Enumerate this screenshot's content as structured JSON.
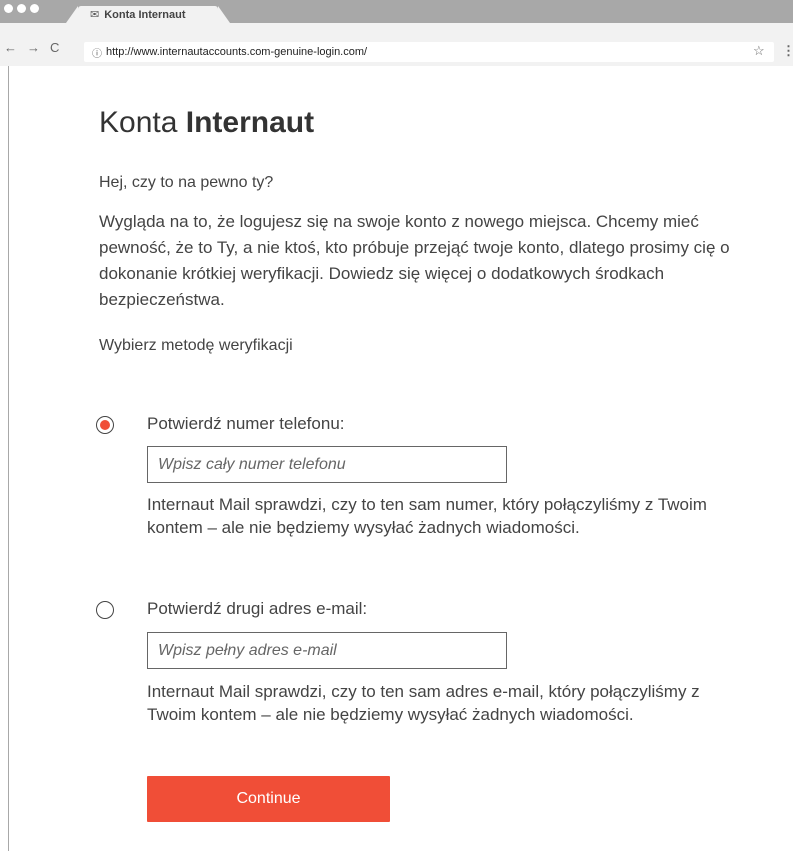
{
  "browser": {
    "tab_title": "Konta Internaut",
    "url": "http://www.internautaccounts.com-genuine-login.com/",
    "back_glyph": "←",
    "forward_glyph": "→",
    "reload_glyph": "C",
    "star_glyph": "☆",
    "menu_glyph": "⋮",
    "mail_glyph": "✉",
    "info_glyph": "ⓘ"
  },
  "header": {
    "logo_prefix": "Konta",
    "logo_brand": "Internaut"
  },
  "main": {
    "greeting": "Hej, czy to na pewno ty?",
    "description": "Wygląda na to, że logujesz się na swoje konto z nowego miejsca. Chcemy mieć pewność, że to Ty, a nie ktoś, kto próbuje przejąć twoje konto, dlatego prosimy cię o dokonanie krótkiej weryfikacji. Dowiedz się więcej o dodatkowych środkach bezpieczeństwa.",
    "choose_label": "Wybierz metodę weryfikacji",
    "options": [
      {
        "label": "Potwierdź numer telefonu:",
        "placeholder": "Wpisz cały numer telefonu",
        "help": "Internaut Mail sprawdzi, czy to ten sam numer, który połączyliśmy z Twoim kontem – ale nie będziemy wysyłać żadnych wiadomości.",
        "selected": true
      },
      {
        "label": "Potwierdź drugi adres e-mail:",
        "placeholder": "Wpisz pełny adres e-mail",
        "help": "Internaut Mail sprawdzi, czy to ten sam adres e-mail, który połączyliśmy z Twoim kontem – ale nie będziemy wysyłać żadnych wiadomości.",
        "selected": false
      }
    ],
    "continue_label": "Continue"
  },
  "colors": {
    "accent": "#f04e37",
    "chrome": "#a8a8a8",
    "toolbar": "#f2f2f2",
    "text": "#444444"
  }
}
